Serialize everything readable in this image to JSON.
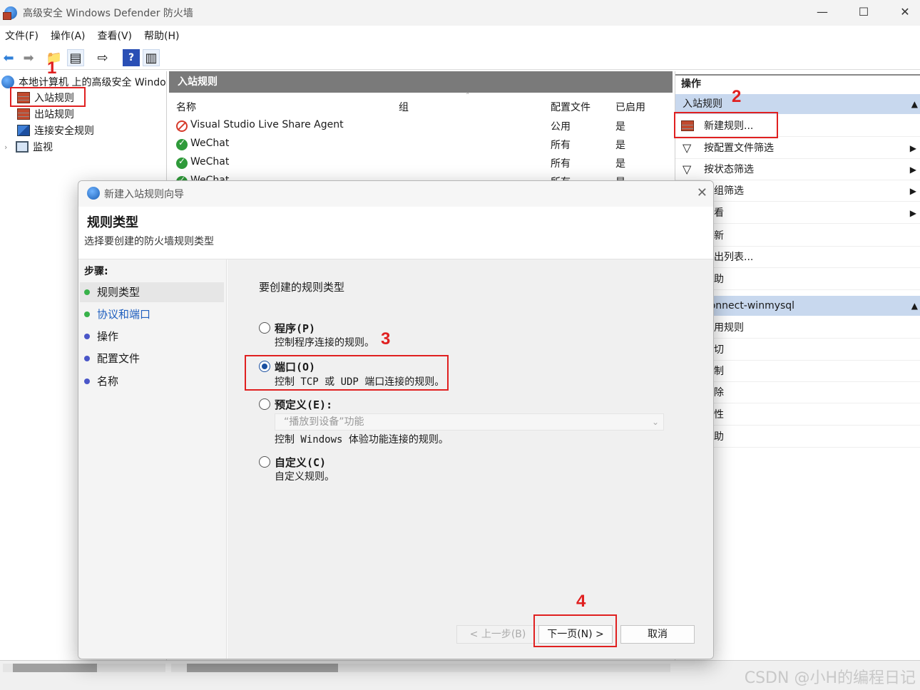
{
  "window": {
    "title": "高级安全 Windows Defender 防火墙",
    "controls": [
      "—",
      "☐",
      "✕"
    ]
  },
  "menu": [
    "文件(F)",
    "操作(A)",
    "查看(V)",
    "帮助(H)"
  ],
  "tree": {
    "root": "本地计算机 上的高级安全 Windo",
    "items": [
      "入站规则",
      "出站规则",
      "连接安全规则",
      "监视"
    ]
  },
  "center": {
    "header": "入站规则",
    "columns": [
      "名称",
      "组",
      "配置文件",
      "已启用"
    ],
    "rows": [
      {
        "name": "Visual Studio Live Share Agent",
        "group": "",
        "profile": "公用",
        "enabled": "是",
        "status": "blocked"
      },
      {
        "name": "WeChat",
        "group": "",
        "profile": "所有",
        "enabled": "是",
        "status": "allowed"
      },
      {
        "name": "WeChat",
        "group": "",
        "profile": "所有",
        "enabled": "是",
        "status": "allowed"
      },
      {
        "name": "WeChat",
        "group": "",
        "profile": "所有",
        "enabled": "是",
        "status": "allowed"
      }
    ]
  },
  "actions": {
    "header": "操作",
    "section1": "入站规则",
    "items": [
      "新建规则...",
      "按配置文件筛选",
      "按状态筛选",
      "按组筛选",
      "查看",
      "刷新",
      "导出列表...",
      "帮助"
    ],
    "section2": "connect-winmysql",
    "items2": [
      "禁用规则",
      "剪切",
      "复制",
      "删除",
      "属性",
      "帮助"
    ]
  },
  "dialog": {
    "title": "新建入站规则向导",
    "close": "✕",
    "heading": "规则类型",
    "subheading": "选择要创建的防火墙规则类型",
    "steps_label": "步骤:",
    "steps": [
      "规则类型",
      "协议和端口",
      "操作",
      "配置文件",
      "名称"
    ],
    "prompt": "要创建的规则类型",
    "options": [
      {
        "title": "程序(P)",
        "desc": "控制程序连接的规则。",
        "checked": false
      },
      {
        "title": "端口(O)",
        "desc": "控制 TCP 或 UDP 端口连接的规则。",
        "checked": true
      },
      {
        "title": "预定义(E):",
        "desc": "控制 Windows 体验功能连接的规则。",
        "checked": false
      },
      {
        "title": "自定义(C)",
        "desc": "自定义规则。",
        "checked": false
      }
    ],
    "predefined_value": "“播放到设备”功能",
    "buttons": {
      "back": "< 上一步(B)",
      "next": "下一页(N) >",
      "cancel": "取消"
    }
  },
  "annotations": [
    "1",
    "2",
    "3",
    "4"
  ],
  "watermark": "CSDN @小H的编程日记",
  "colors": {
    "annotation": "#e02020",
    "section": "#c8d8ee",
    "header_gray": "#7a7a7a"
  }
}
